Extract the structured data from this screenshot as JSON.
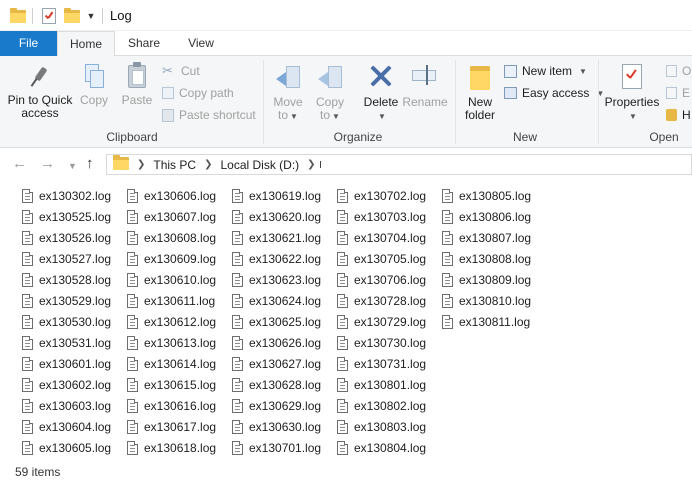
{
  "window": {
    "title": "Log"
  },
  "ribbon_tabs": [
    "File",
    "Home",
    "Share",
    "View"
  ],
  "ribbon": {
    "clipboard": {
      "label": "Clipboard",
      "pin_label_1": "Pin to Quick",
      "pin_label_2": "access",
      "copy": "Copy",
      "paste": "Paste",
      "cut": "Cut",
      "copy_path": "Copy path",
      "paste_shortcut": "Paste shortcut"
    },
    "organize": {
      "label": "Organize",
      "move_to_1": "Move",
      "move_to_2": "to",
      "copy_to_1": "Copy",
      "copy_to_2": "to",
      "delete": "Delete",
      "rename": "Rename"
    },
    "new": {
      "label": "New",
      "new_folder_1": "New",
      "new_folder_2": "folder",
      "new_item": "New item",
      "easy_access": "Easy access"
    },
    "open": {
      "label": "Open",
      "properties": "Properties",
      "open_short": "O",
      "edit_short": "E",
      "history_short": "H"
    }
  },
  "address": {
    "crumbs": [
      "This PC",
      "Local Disk (D:)"
    ]
  },
  "files": {
    "col1": [
      "ex130302.log",
      "ex130525.log",
      "ex130526.log",
      "ex130527.log",
      "ex130528.log",
      "ex130529.log",
      "ex130530.log",
      "ex130531.log",
      "ex130601.log",
      "ex130602.log",
      "ex130603.log",
      "ex130604.log",
      "ex130605.log"
    ],
    "col2": [
      "ex130606.log",
      "ex130607.log",
      "ex130608.log",
      "ex130609.log",
      "ex130610.log",
      "ex130611.log",
      "ex130612.log",
      "ex130613.log",
      "ex130614.log",
      "ex130615.log",
      "ex130616.log",
      "ex130617.log",
      "ex130618.log"
    ],
    "col3": [
      "ex130619.log",
      "ex130620.log",
      "ex130621.log",
      "ex130622.log",
      "ex130623.log",
      "ex130624.log",
      "ex130625.log",
      "ex130626.log",
      "ex130627.log",
      "ex130628.log",
      "ex130629.log",
      "ex130630.log",
      "ex130701.log"
    ],
    "col4": [
      "ex130702.log",
      "ex130703.log",
      "ex130704.log",
      "ex130705.log",
      "ex130706.log",
      "ex130728.log",
      "ex130729.log",
      "ex130730.log",
      "ex130731.log",
      "ex130801.log",
      "ex130802.log",
      "ex130803.log",
      "ex130804.log"
    ],
    "col5": [
      "ex130805.log",
      "ex130806.log",
      "ex130807.log",
      "ex130808.log",
      "ex130809.log",
      "ex130810.log",
      "ex130811.log"
    ]
  },
  "status": {
    "item_count": "59 items"
  },
  "colors": {
    "accent": "#1979ca",
    "folder": "#ffd764",
    "ribbon_bg": "#f5f6f7"
  }
}
